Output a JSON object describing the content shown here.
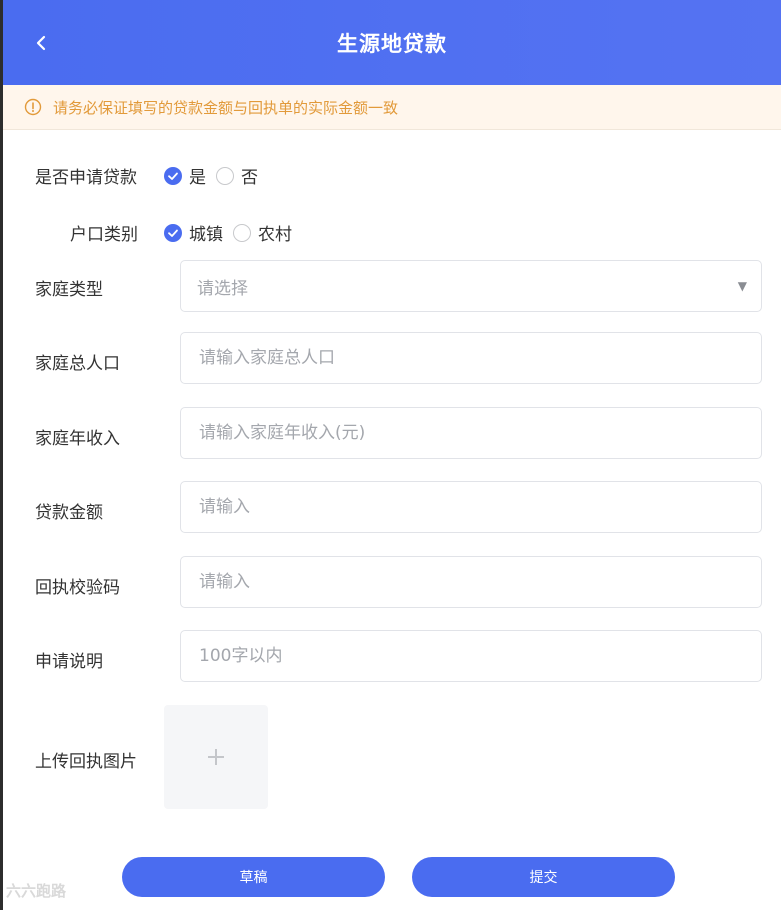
{
  "header": {
    "title": "生源地贷款"
  },
  "notice": {
    "text": "请务必保证填写的贷款金额与回执单的实际金额一致"
  },
  "form": {
    "apply_loan": {
      "label": "是否申请贷款",
      "options": [
        "是",
        "否"
      ],
      "selected": "是"
    },
    "household_type": {
      "label": "户口类别",
      "options": [
        "城镇",
        "农村"
      ],
      "selected": "城镇"
    },
    "family_type": {
      "label": "家庭类型",
      "placeholder": "请选择"
    },
    "family_population": {
      "label": "家庭总人口",
      "placeholder": "请输入家庭总人口"
    },
    "family_income": {
      "label": "家庭年收入",
      "placeholder": "请输入家庭年收入(元)"
    },
    "loan_amount": {
      "label": "贷款金额",
      "placeholder": "请输入"
    },
    "receipt_code": {
      "label": "回执校验码",
      "placeholder": "请输入"
    },
    "description": {
      "label": "申请说明",
      "placeholder": "100字以内"
    },
    "upload": {
      "label": "上传回执图片"
    }
  },
  "buttons": {
    "draft": "草稿",
    "submit": "提交"
  },
  "watermark": "六六跑路",
  "colors": {
    "primary": "#4a6cf0",
    "warning": "#e29a3a",
    "notice_bg": "#fff6ec"
  },
  "icons": {
    "back": "chevron-left-icon",
    "warning": "info-circle-icon",
    "upload": "plus-icon",
    "select": "caret-down-icon"
  }
}
